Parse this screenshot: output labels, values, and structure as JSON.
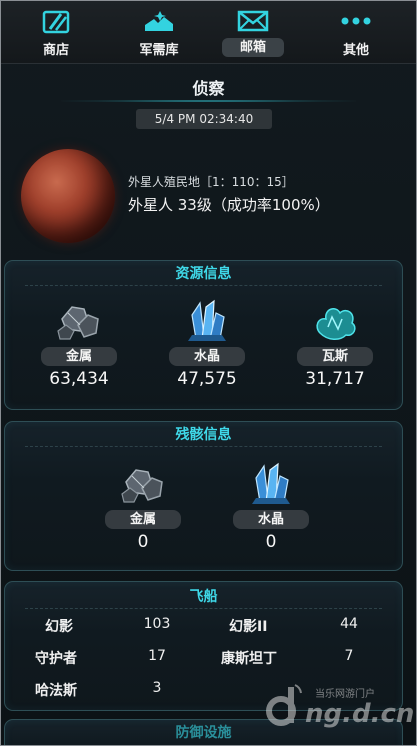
{
  "nav": {
    "tabs": [
      {
        "label": "商店",
        "icon": "shop-card-icon"
      },
      {
        "label": "军需库",
        "icon": "supply-depot-icon"
      },
      {
        "label": "邮箱",
        "icon": "mail-envelope-icon",
        "active": true
      },
      {
        "label": "其他",
        "icon": "more-dots-icon"
      }
    ]
  },
  "report": {
    "title": "侦察",
    "timestamp": "5/4 PM 02:34:40",
    "target_name": "外星人殖民地［1：110：15］",
    "target_info": "外星人 33级（成功率100%）"
  },
  "resources": {
    "title": "资源信息",
    "items": [
      {
        "name": "金属",
        "value": "63,434",
        "icon": "metal-ore-icon"
      },
      {
        "name": "水晶",
        "value": "47,575",
        "icon": "crystal-icon"
      },
      {
        "name": "瓦斯",
        "value": "31,717",
        "icon": "gas-icon"
      }
    ]
  },
  "debris": {
    "title": "残骸信息",
    "items": [
      {
        "name": "金属",
        "value": "0",
        "icon": "metal-ore-icon"
      },
      {
        "name": "水晶",
        "value": "0",
        "icon": "crystal-icon"
      }
    ]
  },
  "ships": {
    "title": "飞船",
    "rows": [
      [
        {
          "name": "幻影",
          "count": "103"
        },
        {
          "name": "幻影II",
          "count": "44"
        }
      ],
      [
        {
          "name": "守护者",
          "count": "17"
        },
        {
          "name": "康斯坦丁",
          "count": "7"
        }
      ],
      [
        {
          "name": "哈法斯",
          "count": "3"
        }
      ]
    ]
  },
  "defense": {
    "title": "防御设施"
  },
  "watermark": {
    "small": "当乐网游门户",
    "big": "ng.d.cn"
  },
  "colors": {
    "accent": "#3fd8e8",
    "background": "#0d1216",
    "panel_border": "#2e4e55"
  }
}
